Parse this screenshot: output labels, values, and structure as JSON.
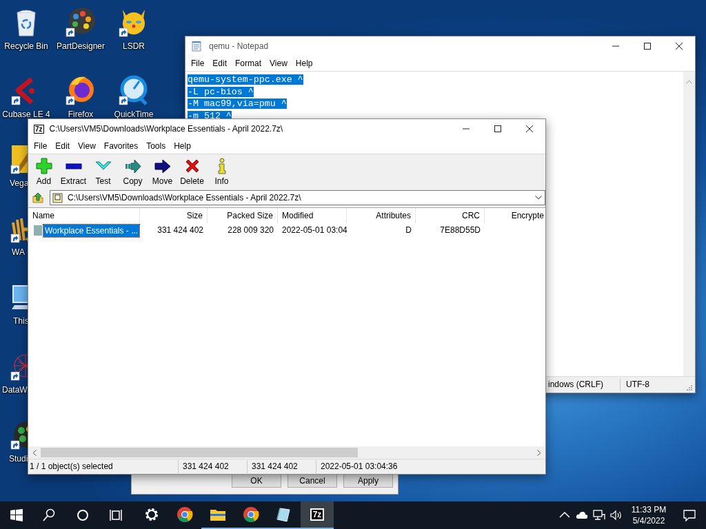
{
  "desktop": {
    "icons": [
      {
        "label": "Recycle Bin"
      },
      {
        "label": "PartDesigner"
      },
      {
        "label": "LSDR"
      },
      {
        "label": "Cubase LE 4"
      },
      {
        "label": "Firefox"
      },
      {
        "label": "QuickTime"
      },
      {
        "label": "Vega"
      },
      {
        "label": "WA"
      },
      {
        "label": "This"
      },
      {
        "label": "DataW"
      },
      {
        "label": "Studi"
      }
    ]
  },
  "notepad": {
    "title": "qemu - Notepad",
    "menu": [
      "File",
      "Edit",
      "Format",
      "View",
      "Help"
    ],
    "lines": [
      {
        "text": "qemu-system-ppc.exe ^",
        "selected": true
      },
      {
        "text": "-L pc-bios ^",
        "selected": true
      },
      {
        "text": "-M mac99,via=pmu ^",
        "selected": true
      },
      {
        "text": "-m 512 ^",
        "selected": true
      }
    ],
    "status": [
      "indows (CRLF)",
      "UTF-8"
    ]
  },
  "dialog": {
    "buttons": [
      "OK",
      "Cancel",
      "Apply"
    ]
  },
  "archive_window": {
    "logo": "7z",
    "title": "C:\\Users\\VM5\\Downloads\\Workplace Essentials - April 2022.7z\\",
    "menu": [
      "File",
      "Edit",
      "View",
      "Favorites",
      "Tools",
      "Help"
    ],
    "toolbar": [
      {
        "label": "Add"
      },
      {
        "label": "Extract"
      },
      {
        "label": "Test"
      },
      {
        "label": "Copy"
      },
      {
        "label": "Move"
      },
      {
        "label": "Delete"
      },
      {
        "label": "Info"
      }
    ],
    "address": "C:\\Users\\VM5\\Downloads\\Workplace Essentials - April 2022.7z\\",
    "columns": [
      "Name",
      "Size",
      "Packed Size",
      "Modified",
      "Attributes",
      "CRC",
      "Encrypte"
    ],
    "rows": [
      {
        "selected": true,
        "cells": [
          "Workplace Essentials - ...",
          "331 424 402",
          "228 009 320",
          "2022-05-01 03:04",
          "D",
          "7E88D55D"
        ]
      }
    ],
    "status": [
      "1 / 1 object(s) selected",
      "331 424 402",
      "331 424 402",
      "2022-05-01 03:04:36"
    ]
  },
  "taskbar": {
    "apps": [
      {
        "kind": "settings",
        "running": false,
        "selected": false
      },
      {
        "kind": "chrome",
        "running": false,
        "selected": false
      },
      {
        "kind": "explorer",
        "running": true,
        "selected": false
      },
      {
        "kind": "chrome",
        "running": true,
        "selected": false
      },
      {
        "kind": "crystal",
        "running": true,
        "selected": false
      },
      {
        "kind": "sevenzip",
        "logo": "7z",
        "running": true,
        "selected": true
      }
    ],
    "clock": {
      "time": "11:33 PM",
      "date": "5/4/2022"
    }
  }
}
